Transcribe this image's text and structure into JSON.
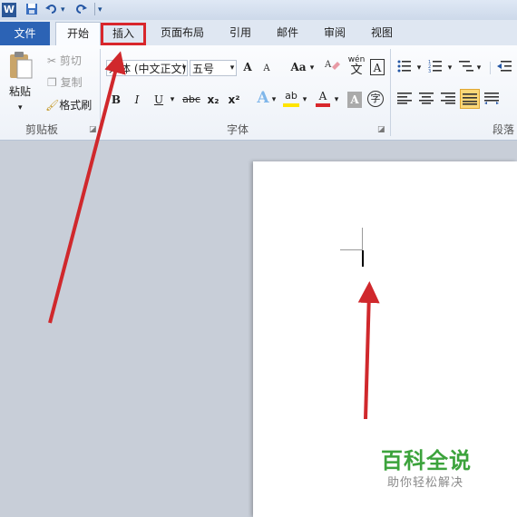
{
  "quick_access": {
    "app_icon_letter": "W",
    "save_icon": "save-icon",
    "undo_icon": "undo-icon",
    "redo_icon": "redo-icon",
    "customize_icon": "customize-dropdown-icon"
  },
  "tabs": [
    {
      "label": "文件"
    },
    {
      "label": "开始"
    },
    {
      "label": "插入"
    },
    {
      "label": "页面布局"
    },
    {
      "label": "引用"
    },
    {
      "label": "邮件"
    },
    {
      "label": "审阅"
    },
    {
      "label": "视图"
    }
  ],
  "clipboard": {
    "paste_label": "粘贴",
    "cut_label": "剪切",
    "copy_label": "复制",
    "format_painter_label": "格式刷",
    "group_label": "剪贴板"
  },
  "font": {
    "font_name": "宋体 (中文正文)",
    "font_size": "五号",
    "grow_glyph": "A",
    "shrink_glyph": "A",
    "case_glyph": "Aa",
    "phonetic_glyph": "wén",
    "phonetic_char": "文",
    "border_glyph": "A",
    "bold": "B",
    "italic": "I",
    "underline": "U",
    "strike": "abc",
    "subscript": "x₂",
    "superscript": "x²",
    "effect_glyph": "A",
    "highlight_glyph": "ab",
    "color_glyph": "A",
    "shade_glyph": "A",
    "circle_glyph": "字",
    "group_label": "字体"
  },
  "paragraph": {
    "group_label": "段落"
  },
  "watermark": {
    "title": "百科全说",
    "subtitle": "助你轻松解决"
  },
  "colors": {
    "file_tab": "#2c63b5",
    "highlight_box": "#d8262b",
    "arrow": "#d0282c",
    "watermark_green": "#3ca33c"
  }
}
